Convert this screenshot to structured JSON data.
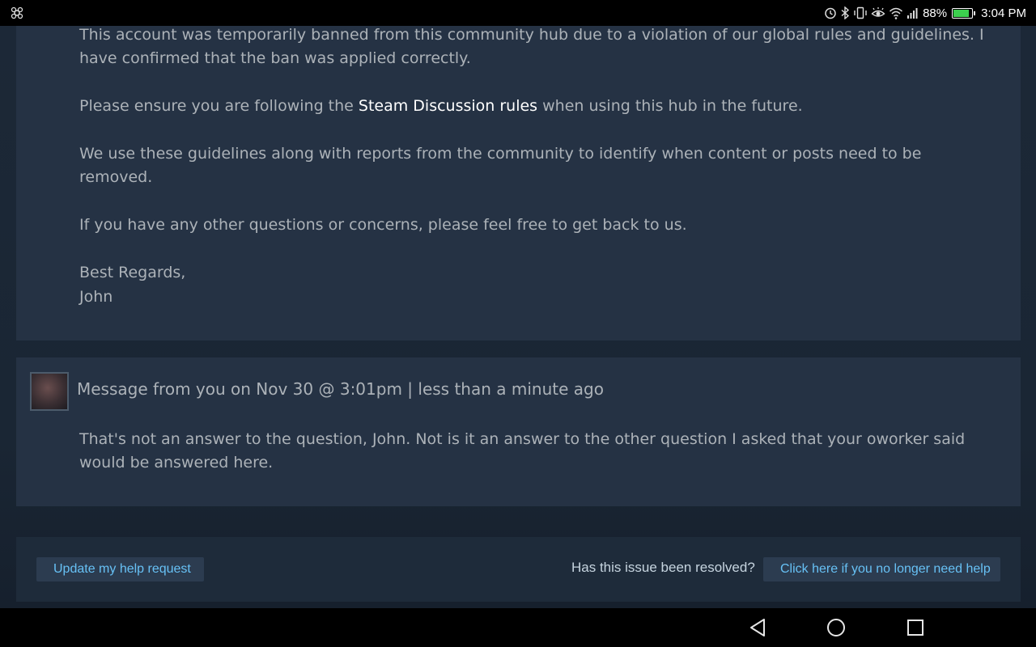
{
  "status_bar": {
    "battery_percent": "88%",
    "battery_level": 0.88,
    "time": "3:04 PM",
    "icons": [
      "app-notification-icon",
      "alarm-icon",
      "bluetooth-icon",
      "vibrate-icon",
      "eye-comfort-icon",
      "wifi-icon",
      "signal-icon",
      "battery-icon"
    ],
    "battery_color": "#3ccf4e"
  },
  "support_reply": {
    "paragraph_1": "This account was temporarily banned from this community hub due to a violation of our global rules and guidelines. I have confirmed that the ban was applied correctly.",
    "paragraph_2_before": "Please ensure you are following the ",
    "paragraph_2_link": "Steam Discussion rules",
    "paragraph_2_after": " when using this hub in the future.",
    "paragraph_3": "We use these guidelines along with reports from the community to identify when content or posts need to be removed.",
    "paragraph_4": "If you have any other questions or concerns, please feel free to get back to us.",
    "closing": "Best Regards,",
    "signature": "John"
  },
  "user_message": {
    "header": "Message from you on Nov 30 @ 3:01pm | less than a minute ago",
    "body": "That's not an answer to the question, John. Not is it an answer to the other question I asked that your oworker said would be answered here."
  },
  "footer": {
    "update_button": "Update my help request",
    "resolved_question": "Has this issue been resolved?",
    "no_longer_need_button": "Click here if you no longer need help"
  },
  "nav_bar": {
    "icons": [
      "back-icon",
      "home-icon",
      "recents-icon"
    ]
  },
  "colors": {
    "background": "#1b2838",
    "panel": "#253244",
    "body_text": "#acb2b8",
    "link": "#ffffff",
    "button_text": "#67c1f5",
    "button_bg": "#2c3c50"
  }
}
